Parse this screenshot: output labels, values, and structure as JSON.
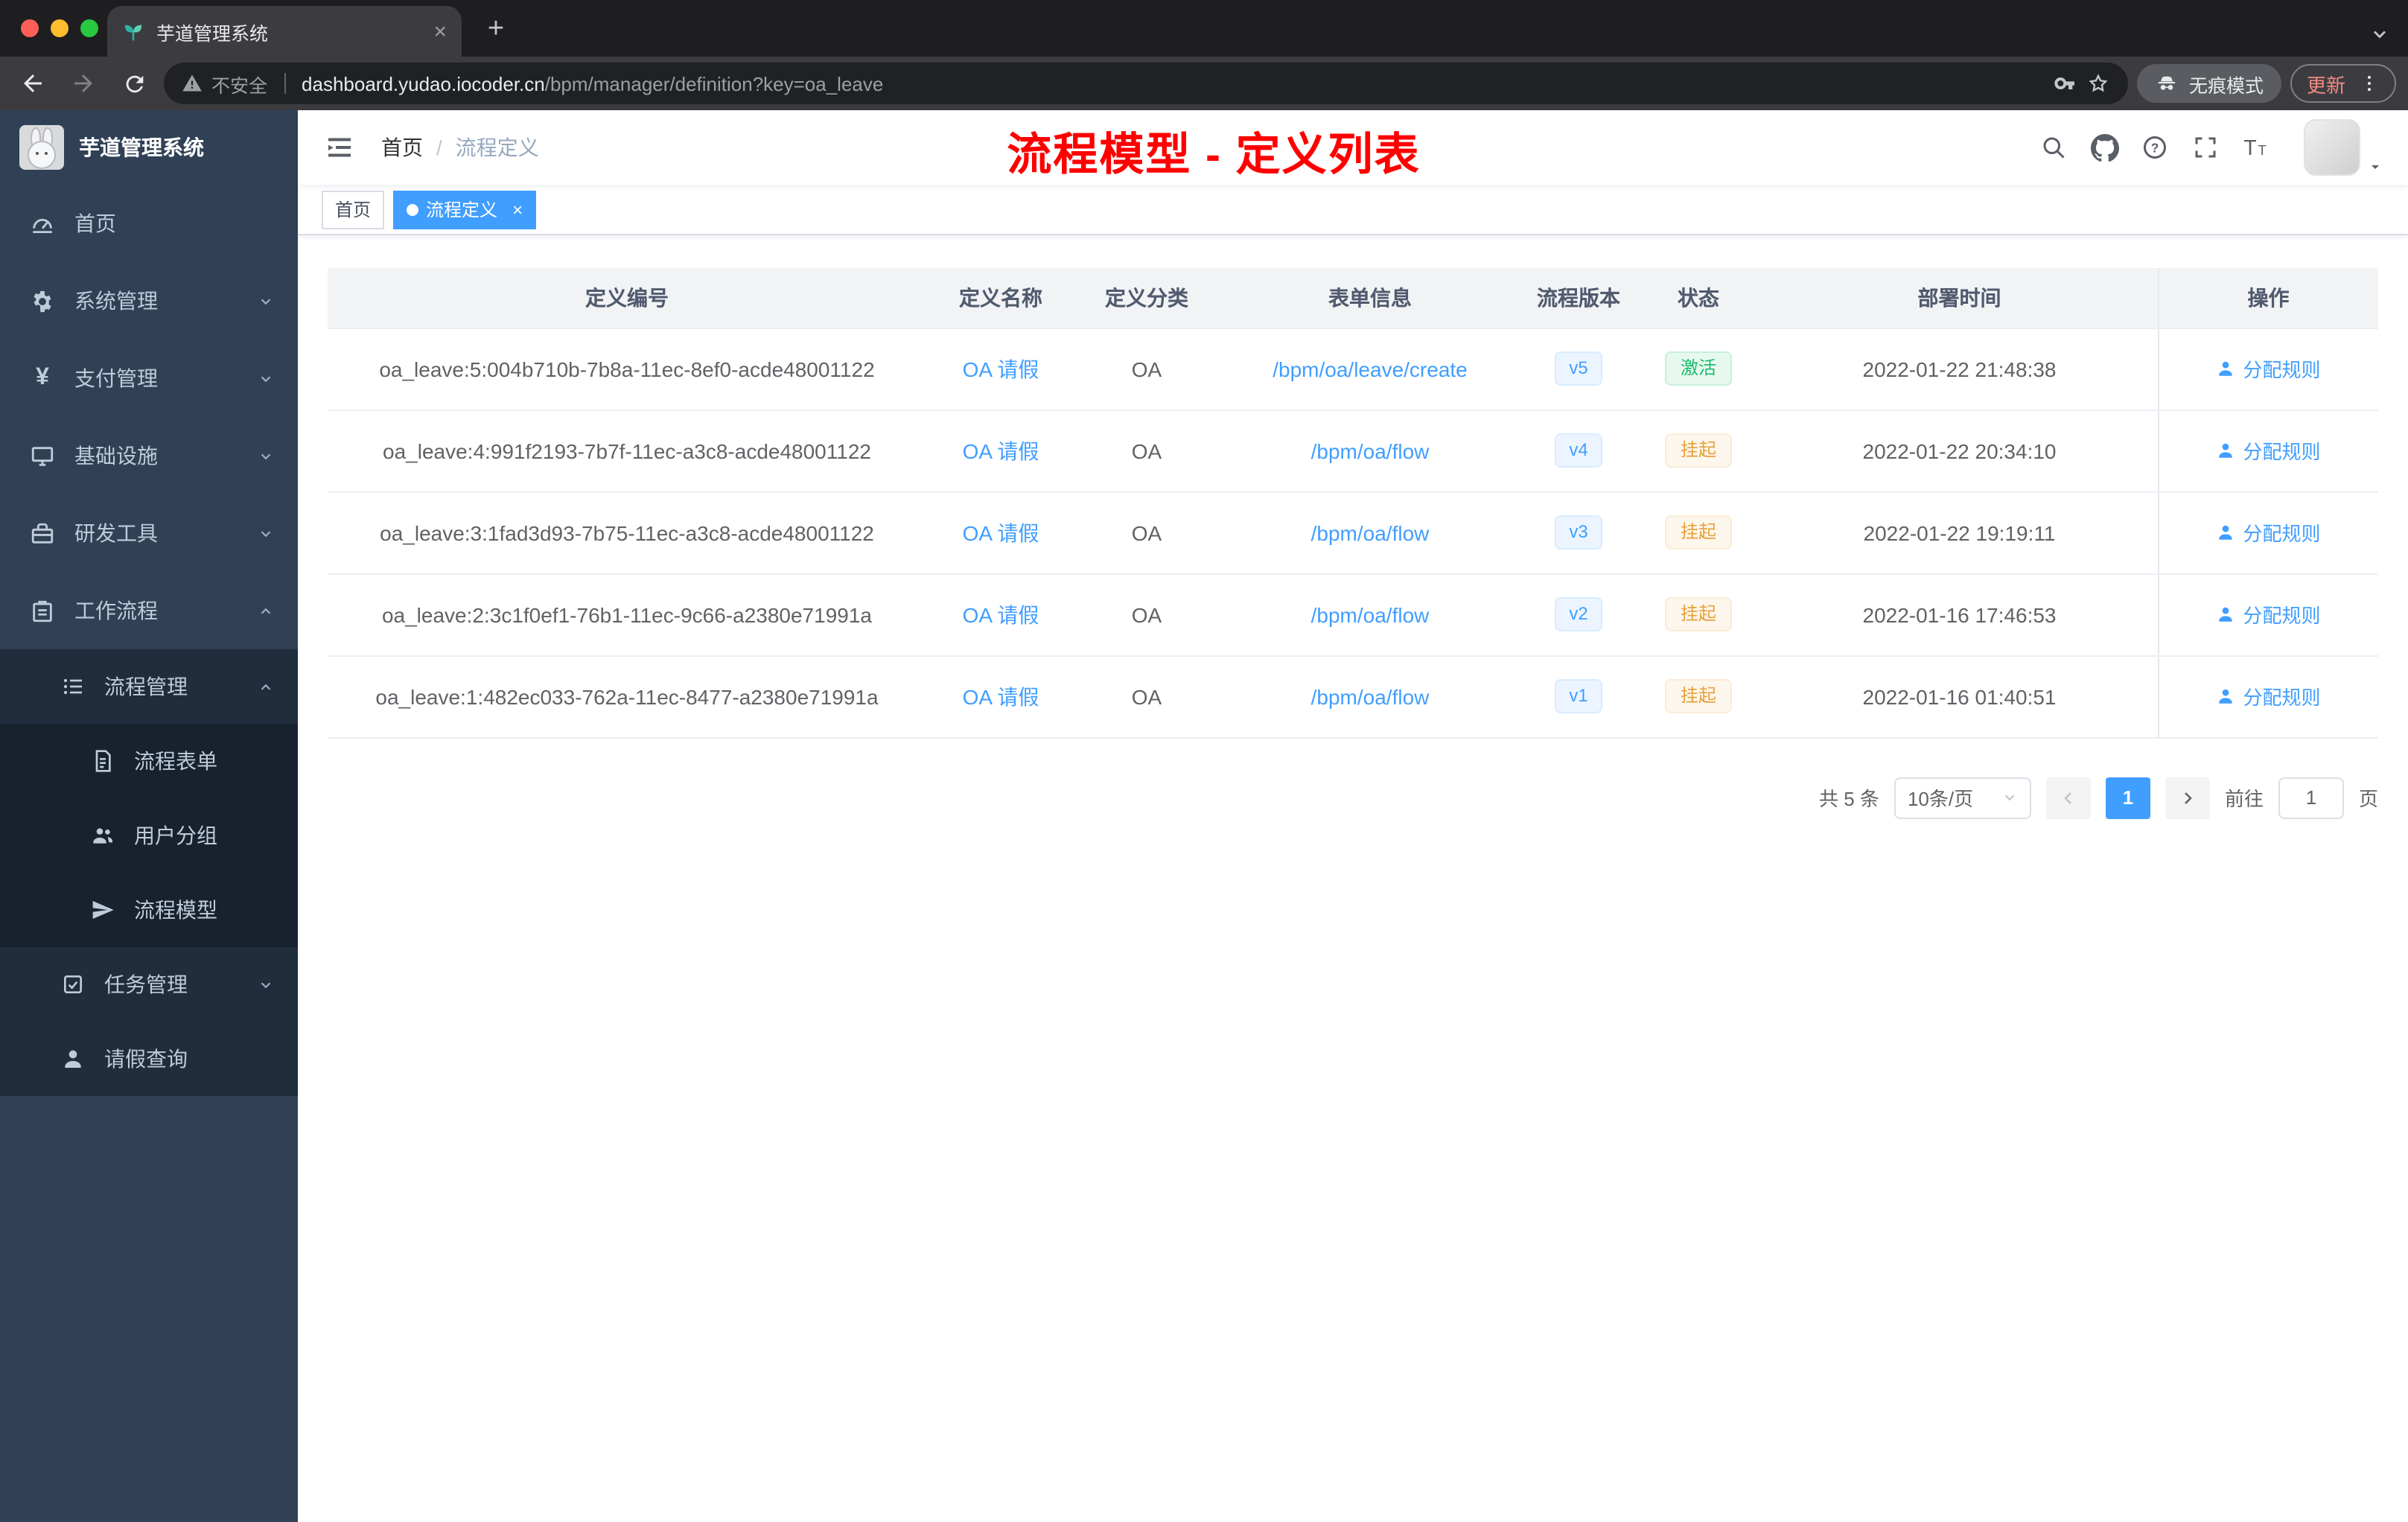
{
  "browser": {
    "tab_title": "芋道管理系统",
    "security_label": "不安全",
    "url_host": "dashboard.yudao.iocoder.cn",
    "url_path": "/bpm/manager/definition?key=oa_leave",
    "incognito_label": "无痕模式",
    "update_label": "更新"
  },
  "sidebar": {
    "app_title": "芋道管理系统",
    "items": [
      {
        "label": "首页"
      },
      {
        "label": "系统管理",
        "expanded": false
      },
      {
        "label": "支付管理",
        "expanded": false
      },
      {
        "label": "基础设施",
        "expanded": false
      },
      {
        "label": "研发工具",
        "expanded": false
      },
      {
        "label": "工作流程",
        "expanded": true
      },
      {
        "label": "流程管理",
        "expanded": true
      },
      {
        "label": "流程表单"
      },
      {
        "label": "用户分组"
      },
      {
        "label": "流程模型"
      },
      {
        "label": "任务管理",
        "expanded": false
      },
      {
        "label": "请假查询"
      }
    ]
  },
  "header": {
    "breadcrumb_home": "首页",
    "breadcrumb_separator": "/",
    "breadcrumb_current": "流程定义",
    "page_title": "流程模型 - 定义列表"
  },
  "tags": {
    "home": "首页",
    "active": "流程定义",
    "close": "×"
  },
  "table": {
    "columns": [
      "定义编号",
      "定义名称",
      "定义分类",
      "表单信息",
      "流程版本",
      "状态",
      "部署时间",
      "操作"
    ],
    "rows": [
      {
        "id": "oa_leave:5:004b710b-7b8a-11ec-8ef0-acde48001122",
        "name": "OA 请假",
        "category": "OA",
        "form": "/bpm/oa/leave/create",
        "version": "v5",
        "status": "激活",
        "status_type": "success",
        "time": "2022-01-22 21:48:38",
        "action": "分配规则"
      },
      {
        "id": "oa_leave:4:991f2193-7b7f-11ec-a3c8-acde48001122",
        "name": "OA 请假",
        "category": "OA",
        "form": "/bpm/oa/flow",
        "version": "v4",
        "status": "挂起",
        "status_type": "warning",
        "time": "2022-01-22 20:34:10",
        "action": "分配规则"
      },
      {
        "id": "oa_leave:3:1fad3d93-7b75-11ec-a3c8-acde48001122",
        "name": "OA 请假",
        "category": "OA",
        "form": "/bpm/oa/flow",
        "version": "v3",
        "status": "挂起",
        "status_type": "warning",
        "time": "2022-01-22 19:19:11",
        "action": "分配规则"
      },
      {
        "id": "oa_leave:2:3c1f0ef1-76b1-11ec-9c66-a2380e71991a",
        "name": "OA 请假",
        "category": "OA",
        "form": "/bpm/oa/flow",
        "version": "v2",
        "status": "挂起",
        "status_type": "warning",
        "time": "2022-01-16 17:46:53",
        "action": "分配规则"
      },
      {
        "id": "oa_leave:1:482ec033-762a-11ec-8477-a2380e71991a",
        "name": "OA 请假",
        "category": "OA",
        "form": "/bpm/oa/flow",
        "version": "v1",
        "status": "挂起",
        "status_type": "warning",
        "time": "2022-01-16 01:40:51",
        "action": "分配规则"
      }
    ]
  },
  "pagination": {
    "total": "共 5 条",
    "page_size": "10条/页",
    "current_page": "1",
    "goto_label": "前往",
    "goto_value": "1",
    "unit_label": "页"
  },
  "colors": {
    "accent": "#409eff",
    "annotation_red": "#ff0000",
    "success": "#1cba6e",
    "warning": "#e6a23c",
    "sidebar_bg": "#304156"
  }
}
